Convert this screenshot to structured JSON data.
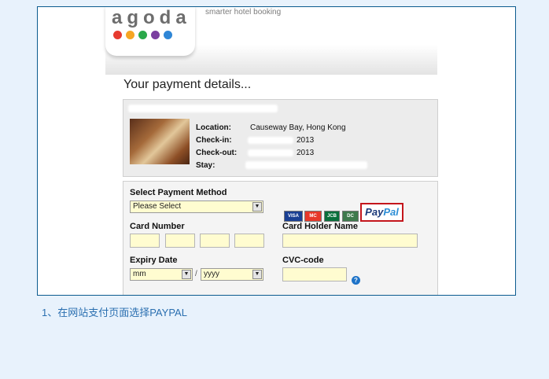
{
  "brand": {
    "logo": "agoda",
    "tagline": "smarter hotel booking",
    "dot_colors": [
      "#e63a2f",
      "#f6a623",
      "#2aa84a",
      "#7b3fa0",
      "#2f86d6"
    ]
  },
  "page_title": "Your payment details...",
  "hotel": {
    "location_label": "Location:",
    "location_value": "Causeway Bay, Hong Kong",
    "checkin_label": "Check-in:",
    "checkin_value": "2013",
    "checkout_label": "Check-out:",
    "checkout_value": "2013",
    "stay_label": "Stay:"
  },
  "payment": {
    "method_label": "Select Payment Method",
    "method_selected": "Please Select",
    "card_logos": [
      "VISA",
      "MC",
      "JCB",
      "DC"
    ],
    "paypal_left": "Pay",
    "paypal_right": "Pal",
    "card_number_label": "Card Number",
    "card_holder_label": "Card Holder Name",
    "expiry_label": "Expiry Date",
    "expiry_month": "mm",
    "expiry_sep": "/",
    "expiry_year": "yyyy",
    "cvc_label": "CVC-code",
    "help_symbol": "?"
  },
  "caption": "1、在网站支付页面选择PAYPAL"
}
